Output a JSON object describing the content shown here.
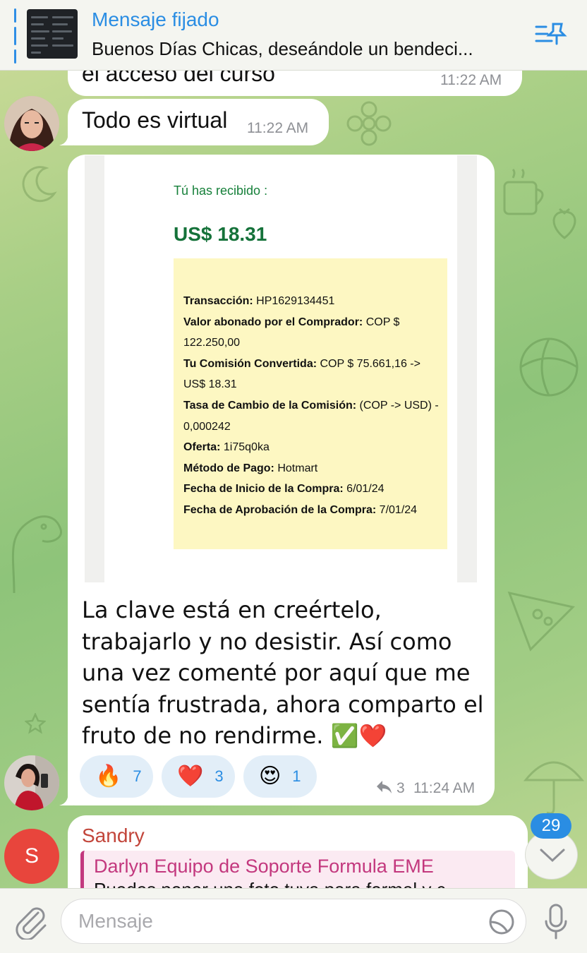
{
  "pinned": {
    "title": "Mensaje fijado",
    "text": "Buenos Días Chicas, deseándole un bendeci..."
  },
  "messages": {
    "prev_partial": {
      "text": "el acceso del curso",
      "time": "11:22 AM"
    },
    "virtual": {
      "text": "Todo es virtual",
      "time": "11:22 AM"
    },
    "receipt_post": {
      "receipt": {
        "label": "Tú has recibido :",
        "amount": "US$ 18.31",
        "rows": [
          {
            "k": "Transacción:",
            "v": " HP1629134451"
          },
          {
            "k": "Valor abonado por el Comprador:",
            "v": " COP $ 122.250,00"
          },
          {
            "k": "Tu Comisión Convertida:",
            "v": " COP $ 75.661,16 -> US$ 18.31"
          },
          {
            "k": "Tasa de Cambio de la Comisión:",
            "v": " (COP -> USD) - 0,000242"
          },
          {
            "k": "Oferta:",
            "v": " 1i75q0ka"
          },
          {
            "k": "Método de Pago:",
            "v": " Hotmart"
          },
          {
            "k": "Fecha de Inicio de la Compra:",
            "v": " 6/01/24"
          },
          {
            "k": "Fecha de Aprobación de la Compra:",
            "v": " 7/01/24"
          }
        ]
      },
      "caption": "La clave está en creértelo, trabajarlo y no desistir. Así como una vez comenté por aquí que me sentía frustrada, ahora comparto el fruto de no rendirme. ✅❤️",
      "reactions": [
        {
          "emoji": "🔥",
          "count": "7"
        },
        {
          "emoji": "❤️",
          "count": "3"
        },
        {
          "emoji": "😍",
          "count": "1"
        }
      ],
      "replies": "3",
      "time": "11:24 AM"
    },
    "sandry": {
      "sender": "Sandry",
      "avatar_initial": "S",
      "reply_to": "Darlyn Equipo de Soporte Formula EME",
      "reply_text": "Puedes poner una foto tuya para formal y c"
    }
  },
  "scroll_badge": "29",
  "composer": {
    "placeholder": "Mensaje"
  },
  "colors": {
    "accent": "#2a8de3",
    "sandry_name": "#c2453a",
    "reply_name": "#c3387e",
    "sandry_avatar": "#e8453c",
    "reaction_bg": "#e2eef8"
  }
}
